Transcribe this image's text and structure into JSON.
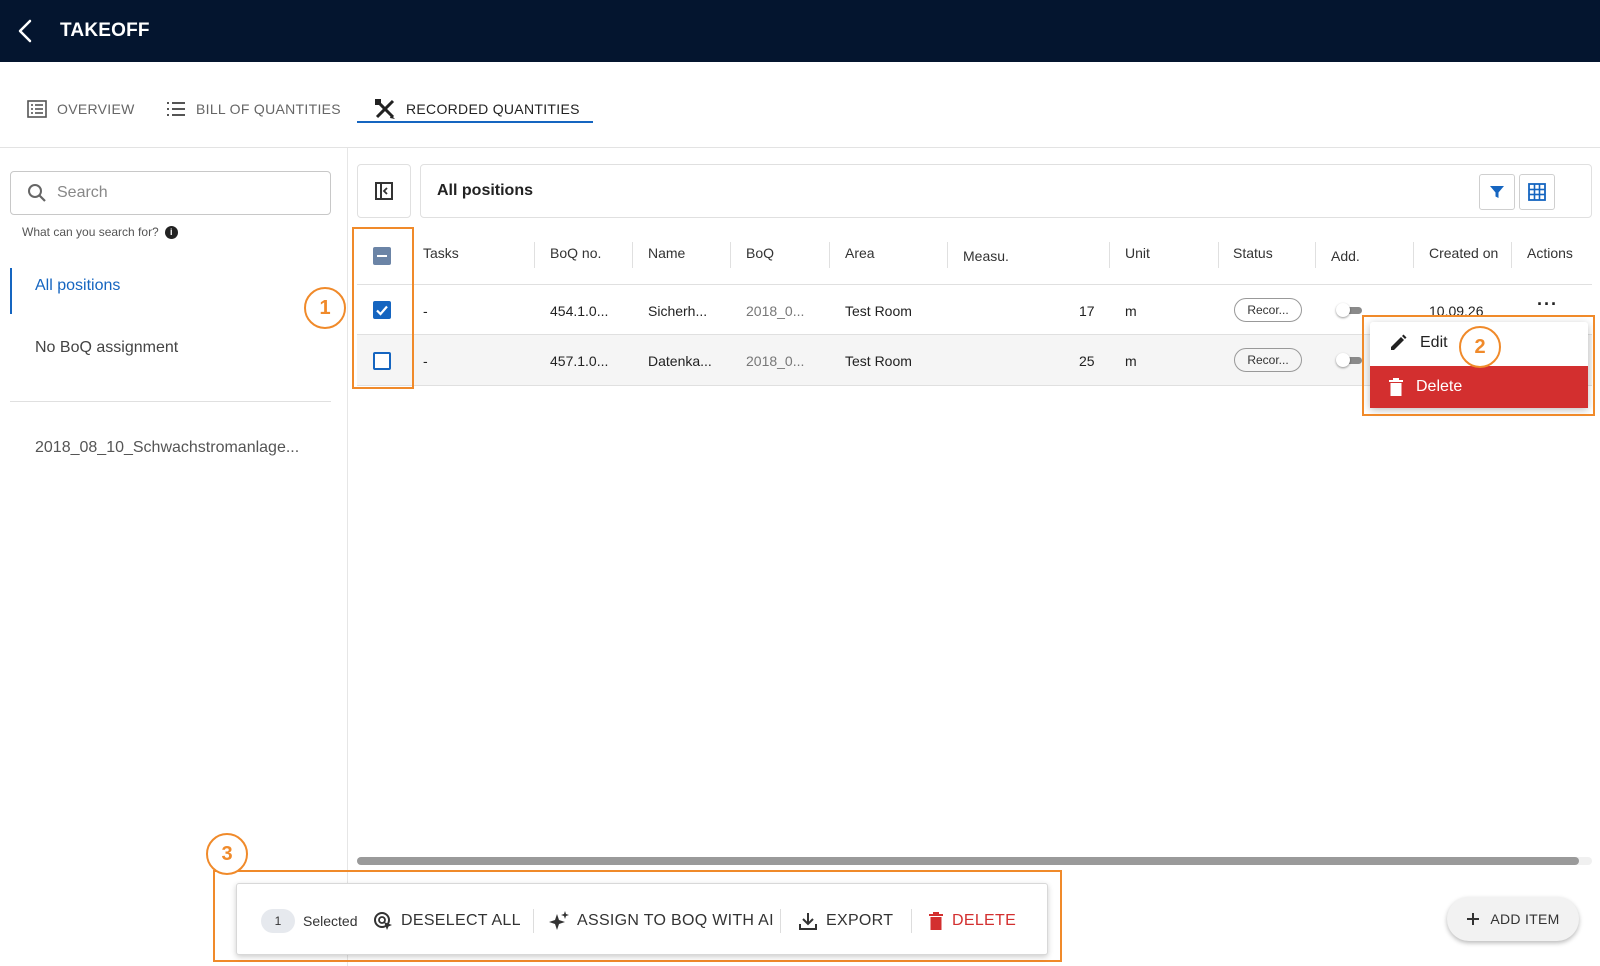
{
  "app": {
    "title": "TAKEOFF"
  },
  "tabs": [
    {
      "label": "OVERVIEW",
      "icon": "list-box-icon"
    },
    {
      "label": "BILL OF QUANTITIES",
      "icon": "list-icon"
    },
    {
      "label": "RECORDED QUANTITIES",
      "icon": "ruler-pencil-icon",
      "active": true
    }
  ],
  "sidebar": {
    "search_placeholder": "Search",
    "search_hint": "What can you search for?",
    "nav": [
      {
        "label": "All positions",
        "active": true
      },
      {
        "label": "No BoQ assignment"
      }
    ],
    "boq_items": [
      "2018_08_10_Schwachstromanlage..."
    ]
  },
  "main": {
    "title": "All positions",
    "columns": [
      "Tasks",
      "BoQ no.",
      "Name",
      "BoQ",
      "Area",
      "Measu.",
      "Unit",
      "Status",
      "Add.",
      "Created on",
      "Actions"
    ],
    "rows": [
      {
        "checked": true,
        "tasks": "-",
        "boq_no": "454.1.0...",
        "name": "Sicherh...",
        "boq": "2018_0...",
        "area": "Test Room",
        "measure": "17",
        "unit": "m",
        "status": "Recor...",
        "created": "10.09.26"
      },
      {
        "checked": false,
        "tasks": "-",
        "boq_no": "457.1.0...",
        "name": "Datenka...",
        "boq": "2018_0...",
        "area": "Test Room",
        "measure": "25",
        "unit": "m",
        "status": "Recor...",
        "created": ""
      }
    ]
  },
  "context_menu": {
    "edit": "Edit",
    "delete": "Delete"
  },
  "annotations": [
    "1",
    "2",
    "3"
  ],
  "selection_bar": {
    "count": "1",
    "selected_label": "Selected",
    "deselect_all": "DESELECT ALL",
    "assign_ai": "ASSIGN TO BOQ WITH AI",
    "export": "EXPORT",
    "delete": "DELETE"
  },
  "add_item": "ADD ITEM",
  "colors": {
    "topbar": "#04152f",
    "accent": "#1565c0",
    "danger": "#d32f2f",
    "annotation": "#f08a2a"
  }
}
